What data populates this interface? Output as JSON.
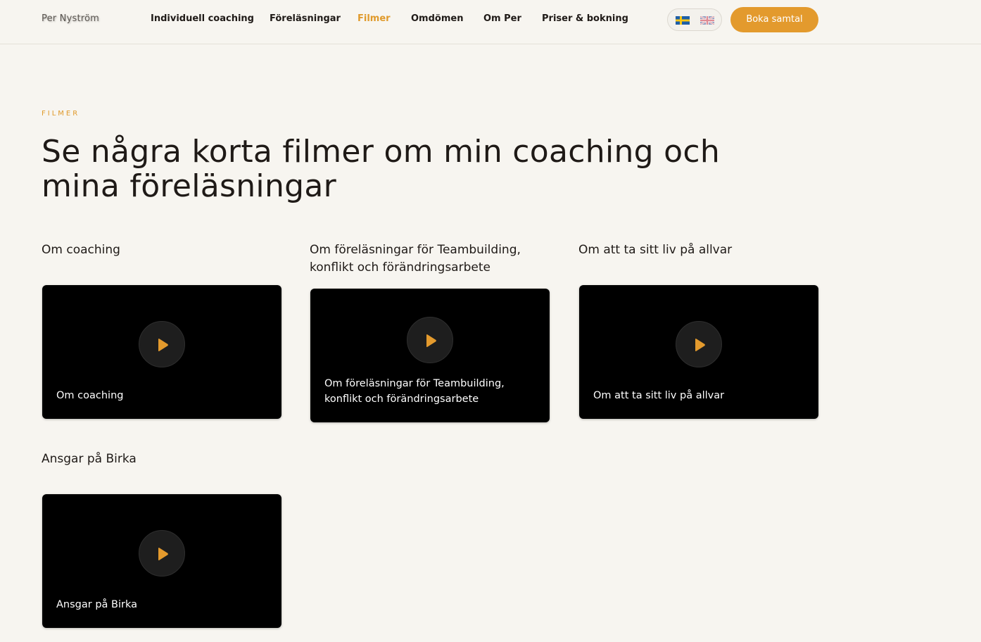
{
  "header": {
    "logo": "Per Nyström",
    "nav": [
      {
        "label": "Individuell coaching",
        "active": false
      },
      {
        "label": "Föreläsningar",
        "active": false
      },
      {
        "label": "Filmer",
        "active": true
      },
      {
        "label": "Omdömen",
        "active": false
      },
      {
        "label": "Om Per",
        "active": false
      },
      {
        "label": "Priser & bokning",
        "active": false
      }
    ],
    "languages": [
      {
        "icon": "sweden-flag-icon",
        "code": "sv",
        "selected": true
      },
      {
        "icon": "uk-flag-icon",
        "code": "en",
        "selected": false
      }
    ],
    "cta_label": "Boka samtal"
  },
  "hero": {
    "eyebrow": "FILMER",
    "headline": "Se några korta filmer om min coaching och mina föreläsningar"
  },
  "videos": [
    {
      "title": "Om coaching",
      "caption": "Om coaching"
    },
    {
      "title": "Om föreläsningar för Teambuilding, konflikt och förändringsarbete",
      "caption": "Om föreläsningar för Teambuilding, konflikt och förändringsarbete"
    },
    {
      "title": "Om att ta sitt liv på allvar",
      "caption": "Om att ta sitt liv på allvar"
    },
    {
      "title": "Ansgar på Birka",
      "caption": "Ansgar på Birka"
    }
  ],
  "colors": {
    "accent": "#e39a2d",
    "background": "#f7f5f0",
    "text": "#1f1a17",
    "card": "#000000"
  }
}
